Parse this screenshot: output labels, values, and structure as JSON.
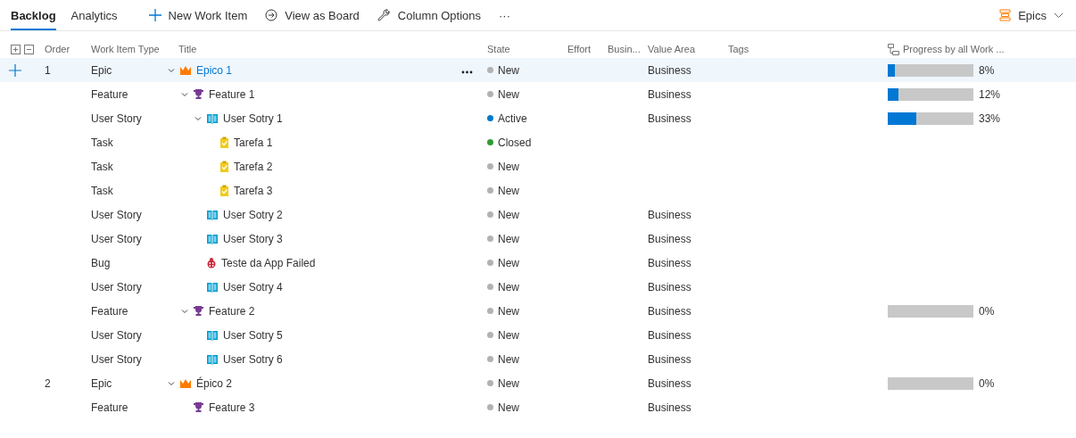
{
  "tabs": [
    {
      "label": "Backlog",
      "selected": true
    },
    {
      "label": "Analytics",
      "selected": false
    }
  ],
  "toolbar": [
    {
      "kind": "new",
      "label": "New Work Item"
    },
    {
      "kind": "board",
      "label": "View as Board"
    },
    {
      "kind": "columns",
      "label": "Column Options"
    },
    {
      "kind": "more",
      "label": "···"
    }
  ],
  "level_picker": {
    "label": "Epics"
  },
  "columns": [
    "Order",
    "Work Item Type",
    "Title",
    "State",
    "Effort",
    "Busin...",
    "Value Area",
    "Tags",
    "Progress by all Work ..."
  ],
  "rows": [
    {
      "order": "1",
      "type": "Epic",
      "kind": "epic",
      "title": "Epico 1",
      "state": "New",
      "color": "#b2b2b2",
      "value_area": "Business",
      "progress": {
        "level": 0.08,
        "label": "8%"
      },
      "expanded": true,
      "selected": true,
      "children": [
        {
          "type": "Feature",
          "kind": "feature",
          "title": "Feature 1",
          "state": "New",
          "color": "#b2b2b2",
          "value_area": "Business",
          "progress": {
            "level": 0.12,
            "label": "12%"
          },
          "expanded": true,
          "selected": false,
          "children": [
            {
              "type": "User Story",
              "kind": "story",
              "title": "User Sotry 1",
              "state": "Active",
              "color": "#007acc",
              "value_area": "Business",
              "progress": {
                "level": 0.33,
                "label": "33%"
              },
              "expanded": true,
              "selected": false,
              "children": [
                {
                  "type": "Task",
                  "kind": "task",
                  "title": "Tarefa 1",
                  "state": "Closed",
                  "color": "#339933",
                  "selected": false
                },
                {
                  "type": "Task",
                  "kind": "task",
                  "title": "Tarefa 2",
                  "state": "New",
                  "color": "#b2b2b2",
                  "selected": false
                },
                {
                  "type": "Task",
                  "kind": "task",
                  "title": "Tarefa 3",
                  "state": "New",
                  "color": "#b2b2b2",
                  "selected": false
                }
              ]
            },
            {
              "type": "User Story",
              "kind": "story",
              "title": "User Sotry 2",
              "state": "New",
              "color": "#b2b2b2",
              "value_area": "Business",
              "selected": false
            },
            {
              "type": "User Story",
              "kind": "story",
              "title": "User Story 3",
              "state": "New",
              "color": "#b2b2b2",
              "value_area": "Business",
              "selected": false
            },
            {
              "type": "Bug",
              "kind": "bug",
              "title": "Teste da App Failed",
              "state": "New",
              "color": "#b2b2b2",
              "value_area": "Business",
              "selected": false
            },
            {
              "type": "User Story",
              "kind": "story",
              "title": "User Sotry 4",
              "state": "New",
              "color": "#b2b2b2",
              "value_area": "Business",
              "selected": false
            }
          ]
        },
        {
          "type": "Feature",
          "kind": "feature",
          "title": "Feature 2",
          "state": "New",
          "color": "#b2b2b2",
          "value_area": "Business",
          "progress": {
            "level": 0,
            "label": "0%"
          },
          "expanded": true,
          "selected": false,
          "children": [
            {
              "type": "User Story",
              "kind": "story",
              "title": "User Sotry 5",
              "state": "New",
              "color": "#b2b2b2",
              "value_area": "Business",
              "selected": false
            },
            {
              "type": "User Story",
              "kind": "story",
              "title": "User Sotry 6",
              "state": "New",
              "color": "#b2b2b2",
              "value_area": "Business",
              "selected": false
            }
          ]
        }
      ]
    },
    {
      "order": "2",
      "type": "Epic",
      "kind": "epic",
      "title": "Épico 2",
      "state": "New",
      "color": "#b2b2b2",
      "value_area": "Business",
      "progress": {
        "level": 0,
        "label": "0%"
      },
      "expanded": true,
      "selected": false,
      "children": [
        {
          "type": "Feature",
          "kind": "feature",
          "title": "Feature 3",
          "state": "New",
          "color": "#b2b2b2",
          "value_area": "Business",
          "selected": false
        }
      ]
    }
  ]
}
